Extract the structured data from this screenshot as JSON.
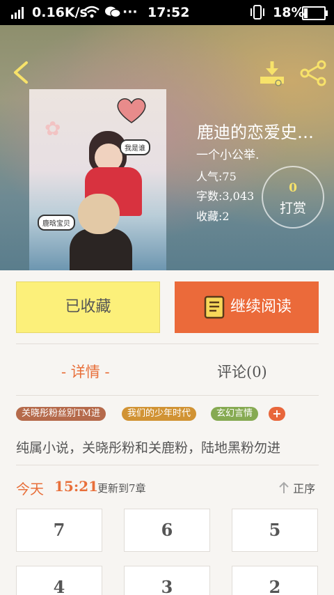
{
  "status": {
    "net_speed": "0.16K/s",
    "dots": "···",
    "time": "17:52",
    "battery": "18%"
  },
  "book": {
    "title": "鹿迪的恋爱史…",
    "author": "一个小公举.",
    "popularity_label": "人气:75",
    "words_label": "字数:3,043",
    "collect_label": "收藏:2",
    "cover_tag1": "我是谁",
    "cover_tag2": "鹿晗宝贝",
    "reward_count": "0",
    "reward_label": "打赏"
  },
  "actions": {
    "collected_label": "已收藏",
    "continue_label": "继续阅读"
  },
  "tabs": {
    "details": "- 详情 -",
    "comments": "评论(0)"
  },
  "tags": [
    {
      "label": "关晓彤粉丝别TM进",
      "color": "#b56a4b"
    },
    {
      "label": "我们的少年时代",
      "color": "#d19334"
    },
    {
      "label": "玄幻言情",
      "color": "#86aa52"
    }
  ],
  "tag_add": "+",
  "description": "纯属小说，关晓彤粉和关鹿粉，陆地黑粉勿进",
  "update": {
    "today": "今天",
    "time": "15:21",
    "text": "更新到7章",
    "sort_label": "正序"
  },
  "chapters": [
    "7",
    "6",
    "5",
    "4",
    "3",
    "2"
  ],
  "colors": {
    "accent": "#eb6a3a",
    "collect_bg": "#fcf07a"
  }
}
